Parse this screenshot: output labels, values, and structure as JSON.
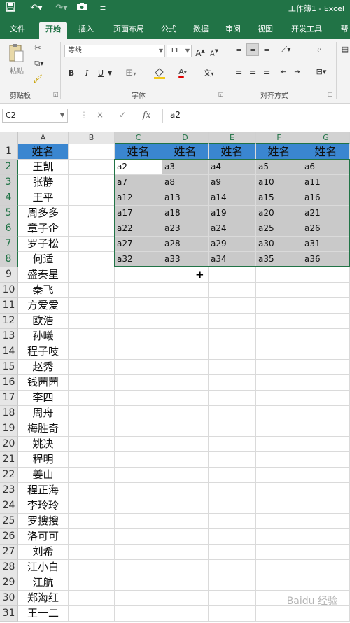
{
  "titlebar": {
    "save_icon": "save-icon",
    "undo_icon": "undo-icon",
    "redo_icon": "redo-icon",
    "camera_icon": "camera-icon",
    "title": "工作簿1  -  Excel"
  },
  "tabs": [
    "文件",
    "开始",
    "插入",
    "页面布局",
    "公式",
    "数据",
    "审阅",
    "视图",
    "开发工具",
    "帮"
  ],
  "ribbon": {
    "paste_label": "粘贴",
    "clipboard_label": "剪贴板",
    "font_name": "等线",
    "font_size": "11",
    "font_label": "字体",
    "align_label": "对齐方式",
    "bold": "B",
    "italic": "I",
    "underline": "U",
    "grow_font": "A",
    "shrink_font": "A",
    "font_color_glyph": "A",
    "phonetic_glyph": "文"
  },
  "formula_bar": {
    "name_box": "C2",
    "cancel": "×",
    "enter": "✓",
    "fx": "fx",
    "formula": "a2"
  },
  "columns": [
    "A",
    "B",
    "C",
    "D",
    "E",
    "F",
    "G"
  ],
  "names": [
    "姓名",
    "王凯",
    "张静",
    "王平",
    "周多多",
    "章子企",
    "罗子松",
    "何适",
    "盛秦星",
    "秦飞",
    "方爱爱",
    "欧浩",
    "孙曦",
    "程子吱",
    "赵秀",
    "钱茜茜",
    "李四",
    "周舟",
    "梅胜奇",
    "姚决",
    "程明",
    "姜山",
    "程正海",
    "李玲玲",
    "罗搜搜",
    "洛可可",
    "刘希",
    "江小白",
    "江航",
    "郑海红",
    "王一二"
  ],
  "table_header": [
    "姓名",
    "姓名",
    "姓名",
    "姓名",
    "姓名"
  ],
  "table_rows": [
    [
      "a2",
      "a3",
      "a4",
      "a5",
      "a6"
    ],
    [
      "a7",
      "a8",
      "a9",
      "a10",
      "a11"
    ],
    [
      "a12",
      "a13",
      "a14",
      "a15",
      "a16"
    ],
    [
      "a17",
      "a18",
      "a19",
      "a20",
      "a21"
    ],
    [
      "a22",
      "a23",
      "a24",
      "a25",
      "a26"
    ],
    [
      "a27",
      "a28",
      "a29",
      "a30",
      "a31"
    ],
    [
      "a32",
      "a33",
      "a34",
      "a35",
      "a36"
    ]
  ],
  "watermark": "Baidu 经验",
  "colors": {
    "accent": "#217346",
    "header_fill": "#3a86d0",
    "selection_fill": "#c9c9c9"
  }
}
